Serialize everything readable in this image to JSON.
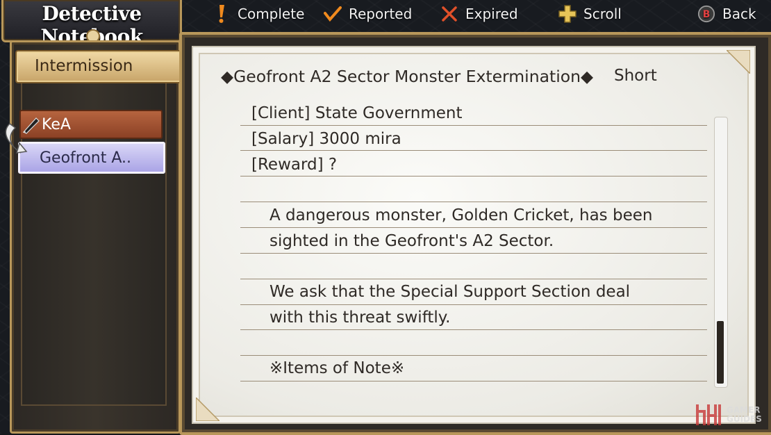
{
  "window": {
    "title": "Detective Notebook"
  },
  "legend": {
    "complete": "Complete",
    "reported": "Reported",
    "expired": "Expired",
    "scroll": "Scroll",
    "back": "Back",
    "back_button": "B"
  },
  "sidebar": {
    "chapter": "Intermission",
    "items": [
      {
        "label": "KeA",
        "state": "reported"
      },
      {
        "label": "Geofront A..",
        "state": "selected"
      }
    ]
  },
  "request": {
    "title": "◆Geofront A2 Sector Monster Extermination◆",
    "length": "Short",
    "client": "[Client]  State Government",
    "salary": "[Salary] 3000 mira",
    "reward": "[Reward] ?",
    "desc_line1": "A dangerous monster, Golden Cricket, has been",
    "desc_line2": "sighted in the Geofront's A2 Sector.",
    "desc_line3": "We ask that the Special Support Section deal",
    "desc_line4": "with this threat swiftly.",
    "notes_heading": "※Items of Note※"
  },
  "scrollbar": {
    "position": 0.78
  },
  "watermark": {
    "line1": "GAMER",
    "line2": "GUIDES"
  },
  "colors": {
    "frame_gold": "#b8975a",
    "tab_red": "#8b4125",
    "tab_selected": "#aaa4e6",
    "complete_orange": "#f08a1e"
  }
}
